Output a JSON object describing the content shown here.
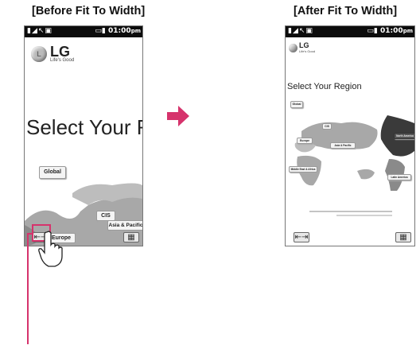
{
  "captions": {
    "before": "[Before Fit To Width]",
    "after": "[After Fit To Width]"
  },
  "status_bar": {
    "left_icons": "signal-icon, call-icon, message-icon",
    "time": "01:00",
    "ampm": "pm"
  },
  "logo": {
    "brand": "LG",
    "tagline": "Life's Good"
  },
  "page": {
    "title_before": "Select Your Reg",
    "title_after": "Select Your Region"
  },
  "regions": {
    "global": "Global",
    "cis": "CIS",
    "europe": "Europe",
    "asia_pacific": "Asia & Pacific",
    "middle_east": "Middle East & Africa",
    "north_america": "North America",
    "latin_america": "Latin America"
  },
  "colors": {
    "accent": "#d6336c",
    "map_land": "#a8a8a8",
    "map_dark": "#3a3a3a",
    "map_sea": "#e0e0e0"
  }
}
